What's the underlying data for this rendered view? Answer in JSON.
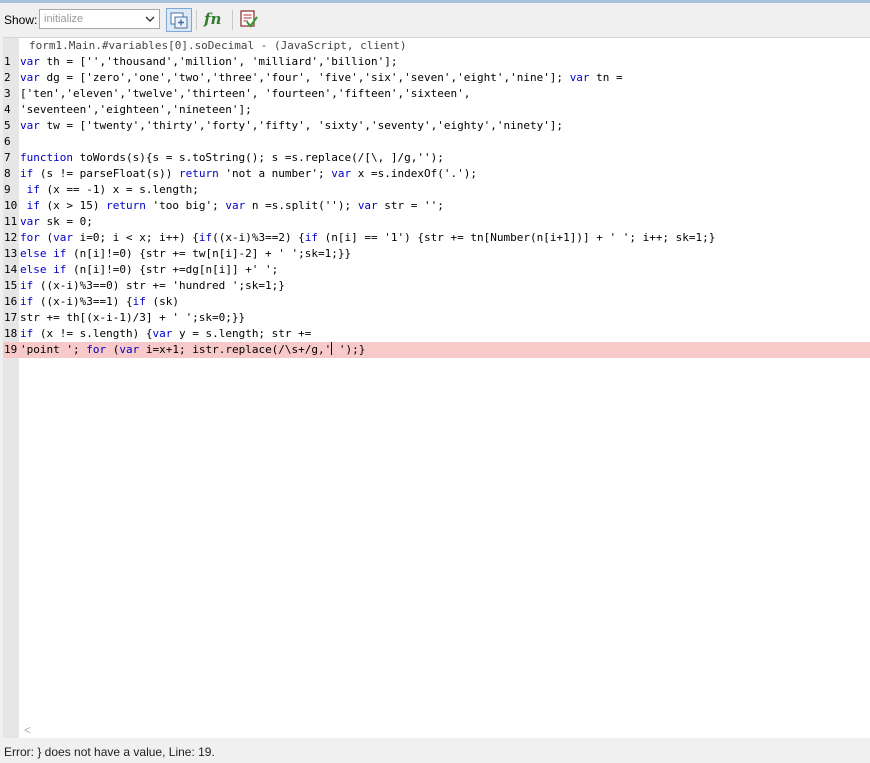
{
  "toolbar": {
    "show_label": "Show:",
    "show_value": "initialize",
    "buttons": [
      {
        "name": "form-objects-icon",
        "active": true
      },
      {
        "name": "functions-icon",
        "label": "fn"
      },
      {
        "name": "check-script-icon"
      }
    ]
  },
  "editor": {
    "title": "form1.Main.#variables[0].soDecimal - (JavaScript, client)",
    "lines": [
      {
        "n": "1",
        "text": "var th = ['','thousand','million', 'milliard','billion'];"
      },
      {
        "n": "2",
        "text": "var dg = ['zero','one','two','three','four', 'five','six','seven','eight','nine']; var tn ="
      },
      {
        "n": "3",
        "text": "['ten','eleven','twelve','thirteen', 'fourteen','fifteen','sixteen',"
      },
      {
        "n": "4",
        "text": "'seventeen','eighteen','nineteen'];"
      },
      {
        "n": "5",
        "text": "var tw = ['twenty','thirty','forty','fifty', 'sixty','seventy','eighty','ninety'];"
      },
      {
        "n": "6",
        "text": ""
      },
      {
        "n": "7",
        "text": "function toWords(s){s = s.toString(); s =s.replace(/[\\, ]/g,'');"
      },
      {
        "n": "8",
        "text": "if (s != parseFloat(s)) return 'not a number'; var x =s.indexOf('.');"
      },
      {
        "n": "9",
        "text": " if (x == -1) x = s.length;"
      },
      {
        "n": "10",
        "text": " if (x > 15) return 'too big'; var n =s.split(''); var str = '';"
      },
      {
        "n": "11",
        "text": "var sk = 0;"
      },
      {
        "n": "12",
        "text": "for (var i=0; i < x; i++) {if((x-i)%3==2) {if (n[i] == '1') {str += tn[Number(n[i+1])] + ' '; i++; sk=1;}"
      },
      {
        "n": "13",
        "text": "else if (n[i]!=0) {str += tw[n[i]-2] + ' ';sk=1;}}"
      },
      {
        "n": "14",
        "text": "else if (n[i]!=0) {str +=dg[n[i]] +' ';"
      },
      {
        "n": "15",
        "text": "if ((x-i)%3==0) str += 'hundred ';sk=1;}"
      },
      {
        "n": "16",
        "text": "if ((x-i)%3==1) {if (sk)"
      },
      {
        "n": "17",
        "text": "str += th[(x-i-1)/3] + ' ';sk=0;}}"
      },
      {
        "n": "18",
        "text": "if (x != s.length) {var y = s.length; str +="
      },
      {
        "n": "19",
        "text": "'point '; for (var i=x+1; istr.replace(/\\s+/g,' ');}"
      }
    ]
  },
  "status": "Error: } does not have a value, Line: 19.",
  "colors": {
    "keyword": "#0000c8",
    "error_highlight": "#f8c9c9",
    "gutter": "#e6e6e6"
  }
}
